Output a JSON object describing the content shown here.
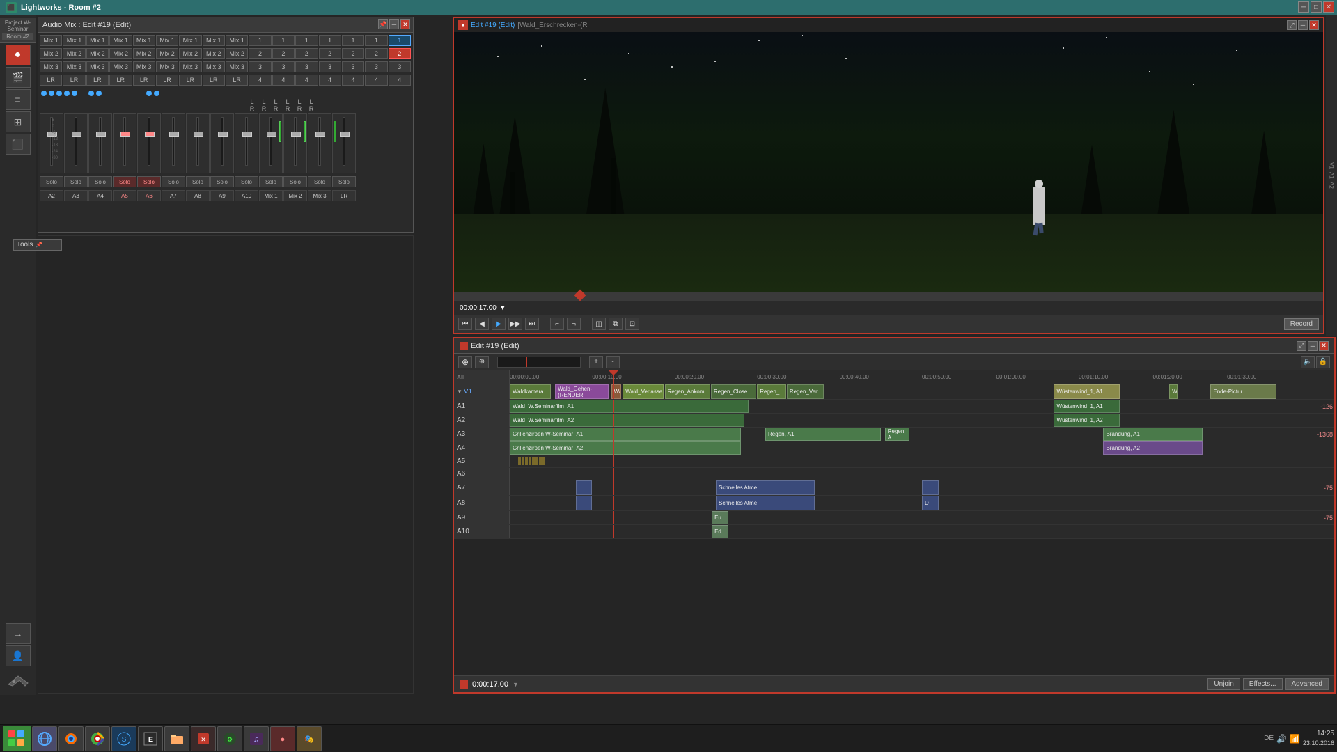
{
  "app": {
    "title": "Lightworks - Room #2",
    "project_label": "Project W-Seminar",
    "room_label": "Room #2"
  },
  "audio_mix": {
    "title": "Audio Mix : Edit #19 (Edit)",
    "rows": {
      "mix1": [
        "Mix 1",
        "Mix 1",
        "Mix 1",
        "Mix 1",
        "Mix 1",
        "Mix 1",
        "Mix 1",
        "Mix 1",
        "Mix 1",
        "1",
        "1",
        "1",
        "1",
        "1",
        "1",
        "1"
      ],
      "mix2": [
        "Mix 2",
        "Mix 2",
        "Mix 2",
        "Mix 2",
        "Mix 2",
        "Mix 2",
        "Mix 2",
        "Mix 2",
        "Mix 2",
        "2",
        "2",
        "2",
        "2",
        "2",
        "2",
        "2"
      ],
      "mix3": [
        "Mix 3",
        "Mix 3",
        "Mix 3",
        "Mix 3",
        "Mix 3",
        "Mix 3",
        "Mix 3",
        "Mix 3",
        "Mix 3",
        "3",
        "3",
        "3",
        "3",
        "3",
        "3",
        "3"
      ],
      "lr": [
        "LR",
        "LR",
        "LR",
        "LR",
        "LR",
        "LR",
        "LR",
        "LR",
        "LR",
        "4",
        "4",
        "4",
        "4",
        "4",
        "4",
        "4"
      ]
    },
    "channels": [
      "A2",
      "A3",
      "A4",
      "A5",
      "A6",
      "A7",
      "A8",
      "A9",
      "A10",
      "Mix 1",
      "Mix 2",
      "Mix 3",
      "LR"
    ],
    "lr_labels": [
      "L",
      "L",
      "L",
      "L",
      "L",
      "L",
      "R",
      "R",
      "R",
      "R",
      "R",
      "R"
    ]
  },
  "preview": {
    "title": "Edit #19 (Edit)",
    "clip_name": "[Wald_Erschrecken-(R",
    "timecode": "00:00:17.00",
    "record_label": "Record",
    "transport_labels": {
      "rewind": "⏮",
      "step_back": "◀",
      "play": "▶",
      "step_fwd": "▶▶",
      "end": "⏭"
    }
  },
  "edit_panel": {
    "title": "Edit #19 (Edit)",
    "timecode": "0:00:17.00"
  },
  "timeline": {
    "ruler_marks": [
      {
        "time": "00:00:00.00",
        "left_pct": 0
      },
      {
        "time": "00:00:10.00",
        "left_pct": 11
      },
      {
        "time": "00:00:20.00",
        "left_pct": 22
      },
      {
        "time": "00:00:30.00",
        "left_pct": 33
      },
      {
        "time": "00:00:40.00",
        "left_pct": 44
      },
      {
        "time": "00:00:50.00",
        "left_pct": 55
      },
      {
        "time": "00:01:00.00",
        "left_pct": 66
      },
      {
        "time": "00:01:10.00",
        "left_pct": 77
      },
      {
        "time": "00:01:20.00",
        "left_pct": 88
      },
      {
        "time": "00:01:30.00",
        "left_pct": 99
      }
    ],
    "tracks": [
      {
        "id": "V1",
        "type": "video",
        "label": "V1",
        "clips": [
          {
            "label": "Waldkamera",
            "start_pct": 0,
            "width_pct": 5,
            "type": "video"
          },
          {
            "label": "Wald_Gehen-(RENDER",
            "start_pct": 5.5,
            "width_pct": 6,
            "type": "video"
          },
          {
            "label": "Wal",
            "start_pct": 11.8,
            "width_pct": 1.2,
            "type": "video"
          },
          {
            "label": "Wald_Verlasse",
            "start_pct": 13.2,
            "width_pct": 5.5,
            "type": "video"
          },
          {
            "label": "Regen_Ankom",
            "start_pct": 18.8,
            "width_pct": 5.5,
            "type": "video"
          },
          {
            "label": "Regen_Close",
            "start_pct": 24.5,
            "width_pct": 5.5,
            "type": "video"
          },
          {
            "label": "Regen_",
            "start_pct": 30,
            "width_pct": 4,
            "type": "video"
          },
          {
            "label": "Regen_Ver",
            "start_pct": 34.2,
            "width_pct": 5,
            "type": "video"
          },
          {
            "label": "Wüstenwind_1, A1",
            "start_pct": 50,
            "width_pct": 9,
            "type": "video"
          },
          {
            "label": "W",
            "start_pct": 80,
            "width_pct": 1,
            "type": "video"
          },
          {
            "label": "Ende-Pictur",
            "start_pct": 84,
            "width_pct": 8,
            "type": "video"
          }
        ]
      },
      {
        "id": "A1",
        "type": "audio",
        "label": "A1",
        "clips": [
          {
            "label": "Wald_W.Seminarfilm_A1",
            "start_pct": 0,
            "width_pct": 29,
            "type": "audio-green"
          },
          {
            "label": "Wüstenwind_1, A1",
            "start_pct": 50,
            "width_pct": 9,
            "type": "audio-green"
          }
        ]
      },
      {
        "id": "A2",
        "type": "audio",
        "label": "A2",
        "clips": [
          {
            "label": "Wald_W.Seminarfilm_A2",
            "start_pct": 0,
            "width_pct": 28,
            "type": "audio-green"
          },
          {
            "label": "Wüstenwind_1, A2",
            "start_pct": 50,
            "width_pct": 9,
            "type": "audio-green"
          }
        ]
      },
      {
        "id": "A3",
        "type": "audio",
        "label": "A3",
        "clips": [
          {
            "label": "Grillenzirpen W-Seminar_A1",
            "start_pct": 0,
            "width_pct": 28,
            "type": "audio-light"
          },
          {
            "label": "Regen, A1",
            "start_pct": 31,
            "width_pct": 14,
            "type": "audio-light"
          },
          {
            "label": "Regen, A",
            "start_pct": 45,
            "width_pct": 3,
            "type": "audio-light"
          },
          {
            "label": "Brandung, A1",
            "start_pct": 71,
            "width_pct": 12,
            "type": "audio-light"
          }
        ]
      },
      {
        "id": "A4",
        "type": "audio",
        "label": "A4",
        "clips": [
          {
            "label": "Grillenzirpen W-Seminar_A2",
            "start_pct": 0,
            "width_pct": 28,
            "type": "audio-light"
          },
          {
            "label": "Brandung, A2",
            "start_pct": 71,
            "width_pct": 12,
            "type": "audio-purple"
          }
        ]
      },
      {
        "id": "A5",
        "type": "audio",
        "label": "A5",
        "clips": [
          {
            "label": "",
            "start_pct": 0,
            "width_pct": 28,
            "type": "audio-yellow"
          }
        ]
      },
      {
        "id": "A6",
        "type": "audio",
        "label": "A6",
        "clips": []
      },
      {
        "id": "A7",
        "type": "audio",
        "label": "A7",
        "clips": [
          {
            "label": "",
            "start_pct": 8,
            "width_pct": 1.5,
            "type": "audio-blue"
          },
          {
            "label": "Schnelles Atme",
            "start_pct": 25,
            "width_pct": 12,
            "type": "audio-blue"
          },
          {
            "label": "",
            "start_pct": 50,
            "width_pct": 1.5,
            "type": "audio-blue"
          }
        ]
      },
      {
        "id": "A8",
        "type": "audio",
        "label": "A8",
        "clips": [
          {
            "label": "",
            "start_pct": 8,
            "width_pct": 1.5,
            "type": "audio-blue"
          },
          {
            "label": "Schnelles Atme",
            "start_pct": 25,
            "width_pct": 12,
            "type": "audio-blue"
          },
          {
            "label": "D",
            "start_pct": 50,
            "width_pct": 1.5,
            "type": "audio-blue"
          }
        ]
      },
      {
        "id": "A9",
        "type": "audio",
        "label": "A9",
        "clips": [
          {
            "label": "Eu",
            "start_pct": 24.5,
            "width_pct": 1,
            "type": "audio-green"
          }
        ]
      },
      {
        "id": "A10",
        "type": "audio",
        "label": "A10",
        "clips": [
          {
            "label": "Ed",
            "start_pct": 24.5,
            "width_pct": 1,
            "type": "audio-green"
          }
        ]
      }
    ],
    "volume_indicators": {
      "A1": "-126",
      "A3": "-1368",
      "A7": "-75",
      "A9": "-75"
    }
  },
  "footer": {
    "timecode": "0:00:17.00",
    "unjoin_label": "Unjoin",
    "effects_label": "Effects...",
    "advanced_label": "Advanced"
  },
  "taskbar": {
    "time": "14:25",
    "date": "23.10.2016",
    "keyboard_layout": "DE"
  }
}
